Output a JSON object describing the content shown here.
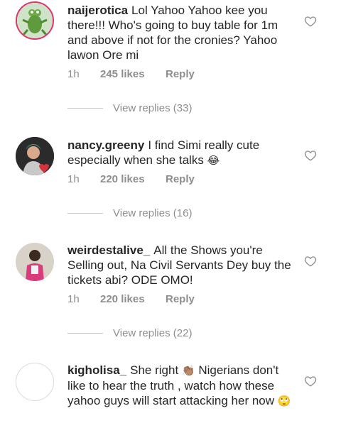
{
  "comments": [
    {
      "username": "naijerotica",
      "text": "Lol Yahoo Yahoo kee you there!!! Who's going to buy table for 1m and above if not for the cronies? Yahoo lawon Ore mi",
      "time": "1h",
      "likes": "245 likes",
      "reply": "Reply",
      "view_replies": "View replies (33)"
    },
    {
      "username": "nancy.greeny",
      "text": "I find Simi really cute especially when she talks",
      "emoji": "😂",
      "time": "1h",
      "likes": "220 likes",
      "reply": "Reply",
      "view_replies": "View replies (16)"
    },
    {
      "username": "weirdestalive_",
      "text": "All the Shows you're Selling out, Na Civil Servants Dey buy the tickets abi? ODE OMO!",
      "time": "1h",
      "likes": "220 likes",
      "reply": "Reply",
      "view_replies": "View replies (22)"
    },
    {
      "username": "kigholisa_",
      "text_a": "She right",
      "emoji_a": "👏🏽",
      "text_b": "Nigerians don't like to hear the truth , watch how these yahoo guys will start attacking her now",
      "emoji_b": "🙄"
    }
  ],
  "icons": {
    "like": "heart-outline-icon"
  },
  "colors": {
    "text": "#262626",
    "muted": "#8e8e8e",
    "story_ring": "#e1306c"
  }
}
